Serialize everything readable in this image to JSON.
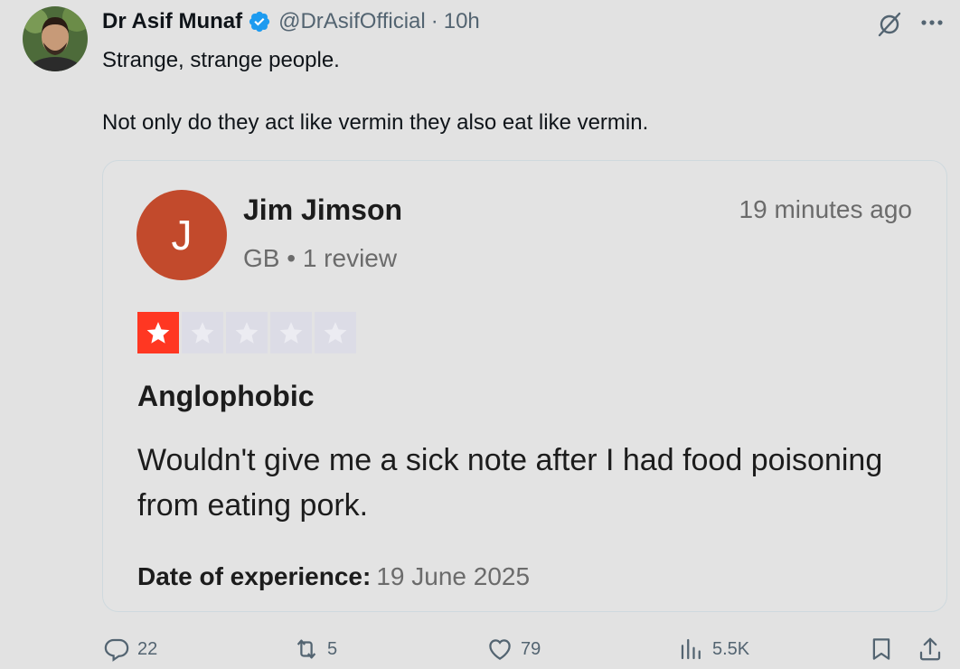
{
  "post": {
    "author_name": "Dr Asif Munaf",
    "handle": "@DrAsifOfficial",
    "separator": "·",
    "time": "10h",
    "text_line1": "Strange, strange people.",
    "text_line2": "Not only do they act like vermin they also eat like vermin."
  },
  "review": {
    "avatar_letter": "J",
    "name": "Jim Jimson",
    "meta": "GB • 1 review",
    "time": "19 minutes ago",
    "rating": 1,
    "rating_max": 5,
    "title": "Anglophobic",
    "body": "Wouldn't give me a sick note after I had food poisoning from eating pork.",
    "date_label": "Date of experience:",
    "date_value": "19 June 2025"
  },
  "actions": {
    "replies": "22",
    "reposts": "5",
    "likes": "79",
    "views": "5.5K"
  },
  "colors": {
    "verified": "#1d9bf0",
    "review_avatar": "#c24a2c",
    "star_filled": "#ff3722",
    "star_empty": "#dcdce6"
  }
}
